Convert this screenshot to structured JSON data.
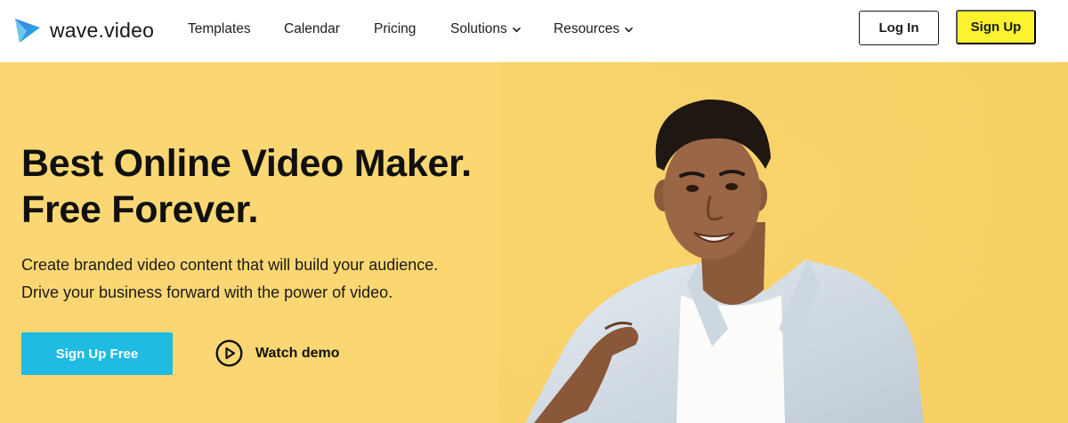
{
  "brand": {
    "name": "wave.video",
    "logo_icon": "wave-video-logo-icon",
    "colors": {
      "teal": "#1fbbe3",
      "blue": "#3f7be0"
    }
  },
  "nav": {
    "links": [
      {
        "label": "Templates",
        "has_dropdown": false
      },
      {
        "label": "Calendar",
        "has_dropdown": false
      },
      {
        "label": "Pricing",
        "has_dropdown": false
      },
      {
        "label": "Solutions",
        "has_dropdown": true,
        "icon": "chevron-down-icon"
      },
      {
        "label": "Resources",
        "has_dropdown": true,
        "icon": "chevron-down-icon"
      }
    ],
    "login_label": "Log In",
    "signup_label": "Sign Up",
    "signup_color": "#fcf230"
  },
  "hero": {
    "title_lines": [
      "Best Online Video Maker.",
      "Free Forever."
    ],
    "subtitle_lines": [
      "Create branded video content that will build your audience.",
      "Drive your business forward with the power of video."
    ],
    "cta_label": "Sign Up Free",
    "cta_color": "#1fbbe3",
    "watch_demo_label": "Watch demo",
    "watch_demo_icon": "play-circle-icon",
    "background_color": "#fbd774"
  }
}
